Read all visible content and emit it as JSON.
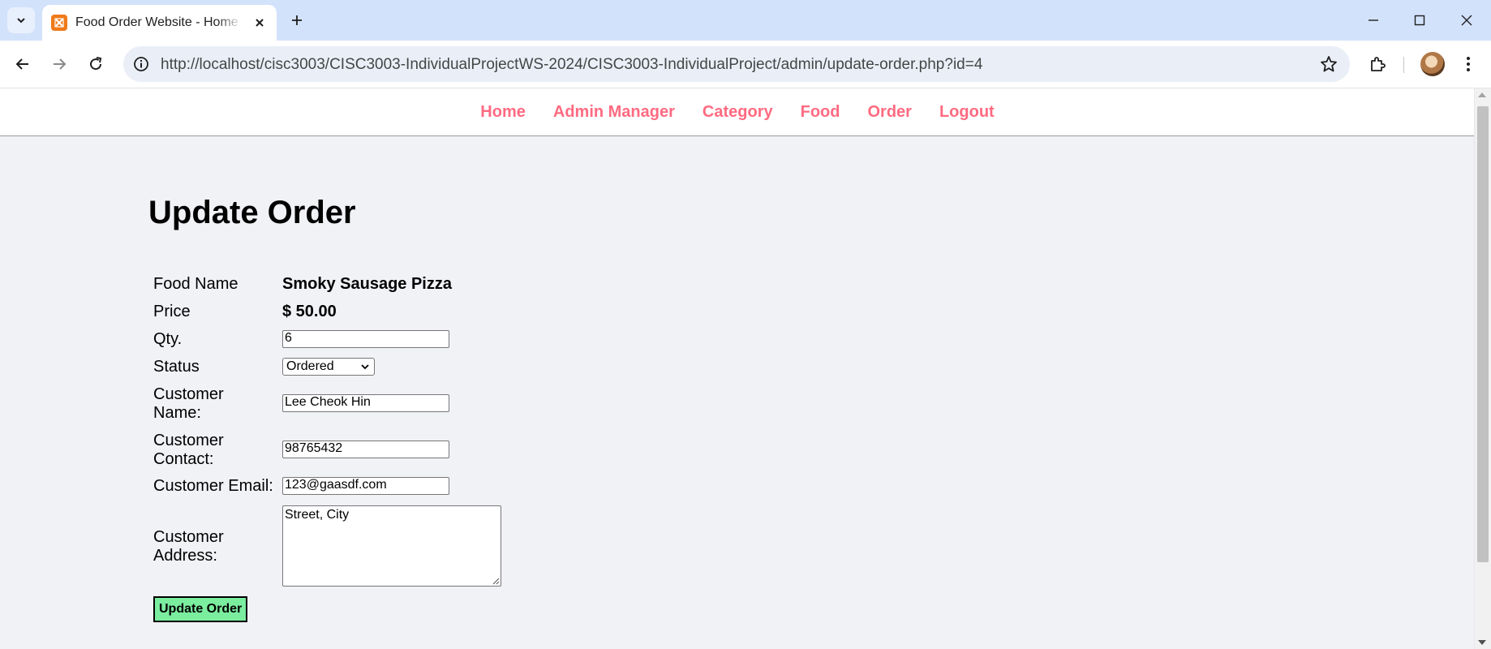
{
  "browser": {
    "tab_title": "Food Order Website - Home Page",
    "url": "http://localhost/cisc3003/CISC3003-IndividualProjectWS-2024/CISC3003-IndividualProject/admin/update-order.php?id=4",
    "icons": {
      "tab_search": "chevron-down-icon",
      "favicon": "xampp-icon",
      "tab_close": "close-icon",
      "new_tab": "plus-icon",
      "back": "arrow-left-icon",
      "forward": "arrow-right-icon",
      "reload": "reload-icon",
      "site_info": "info-icon",
      "bookmark": "star-icon",
      "extensions": "puzzle-icon",
      "menu": "more-vertical-icon"
    }
  },
  "site_nav": {
    "items": [
      {
        "label": "Home"
      },
      {
        "label": "Admin Manager"
      },
      {
        "label": "Category"
      },
      {
        "label": "Food"
      },
      {
        "label": "Order"
      },
      {
        "label": "Logout"
      }
    ],
    "color": "#ff6b81"
  },
  "page": {
    "title": "Update Order"
  },
  "form": {
    "food_name_label": "Food Name",
    "food_name_value": "Smoky Sausage Pizza",
    "price_label": "Price",
    "price_value": "$ 50.00",
    "qty_label": "Qty.",
    "qty_value": "6",
    "status_label": "Status",
    "status_value": "Ordered",
    "customer_name_label_1": "Customer",
    "customer_name_label_2": "Name:",
    "customer_name_value": "Lee Cheok Hin",
    "customer_contact_label_1": "Customer",
    "customer_contact_label_2": "Contact:",
    "customer_contact_value": "98765432",
    "customer_email_label": "Customer Email:",
    "customer_email_value": "123@gaasdf.com",
    "customer_address_label_1": "Customer",
    "customer_address_label_2": "Address:",
    "customer_address_value": "Street, City",
    "submit_label": "Update Order",
    "submit_color": "#7bed9f"
  }
}
